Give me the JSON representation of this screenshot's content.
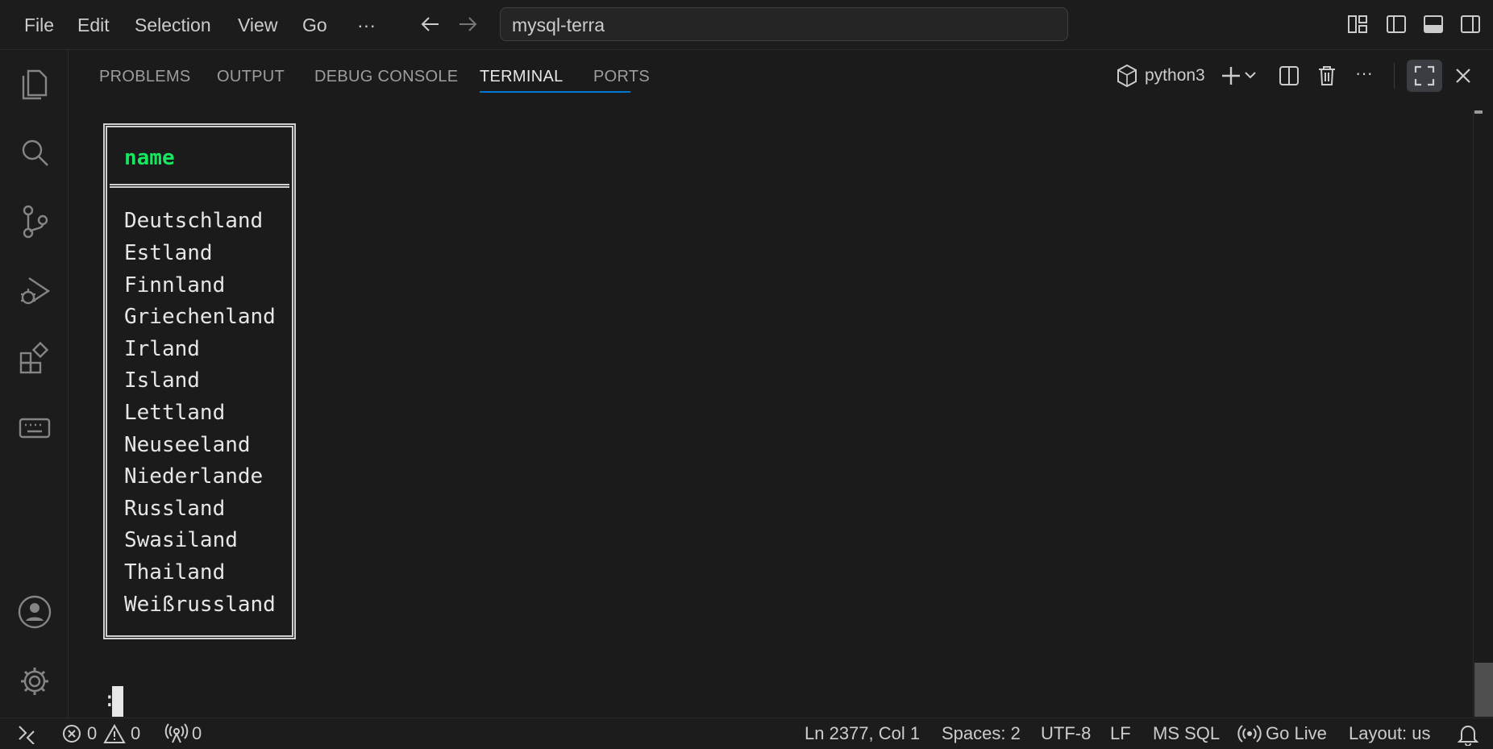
{
  "menu": {
    "items": [
      {
        "label": "File"
      },
      {
        "label": "Edit"
      },
      {
        "label": "Selection"
      },
      {
        "label": "View"
      },
      {
        "label": "Go"
      },
      {
        "label": "···"
      }
    ]
  },
  "command_center": {
    "text": "mysql-terra"
  },
  "activity_bar": {
    "icons": [
      "explorer-icon",
      "search-icon",
      "source-control-icon",
      "run-debug-icon",
      "extensions-icon",
      "keyboard-icon",
      "account-icon",
      "settings-gear-icon"
    ]
  },
  "panel": {
    "tabs": [
      {
        "label": "PROBLEMS"
      },
      {
        "label": "OUTPUT"
      },
      {
        "label": "DEBUG CONSOLE"
      },
      {
        "label": "TERMINAL"
      },
      {
        "label": "PORTS"
      }
    ],
    "active_tab": "TERMINAL",
    "terminal_profile": "python3",
    "more_label": "···"
  },
  "terminal": {
    "header": "name",
    "rows": [
      "Deutschland",
      "Estland",
      "Finnland",
      "Griechenland",
      "Irland",
      "Island",
      "Lettland",
      "Neuseeland",
      "Niederlande",
      "Russland",
      "Swasiland",
      "Thailand",
      "Weißrussland"
    ],
    "prompt": ":"
  },
  "statusbar": {
    "errors": "0",
    "warnings": "0",
    "ports": "0",
    "position": "Ln 2377, Col 1",
    "spaces": "Spaces: 2",
    "encoding": "UTF-8",
    "eol": "LF",
    "language": "MS SQL",
    "go_live": "Go Live",
    "layout": "Layout: us"
  },
  "colors": {
    "background": "#1b1b1b",
    "accent": "#0078d4",
    "header_green": "#16e660",
    "text": "#cccccc"
  }
}
